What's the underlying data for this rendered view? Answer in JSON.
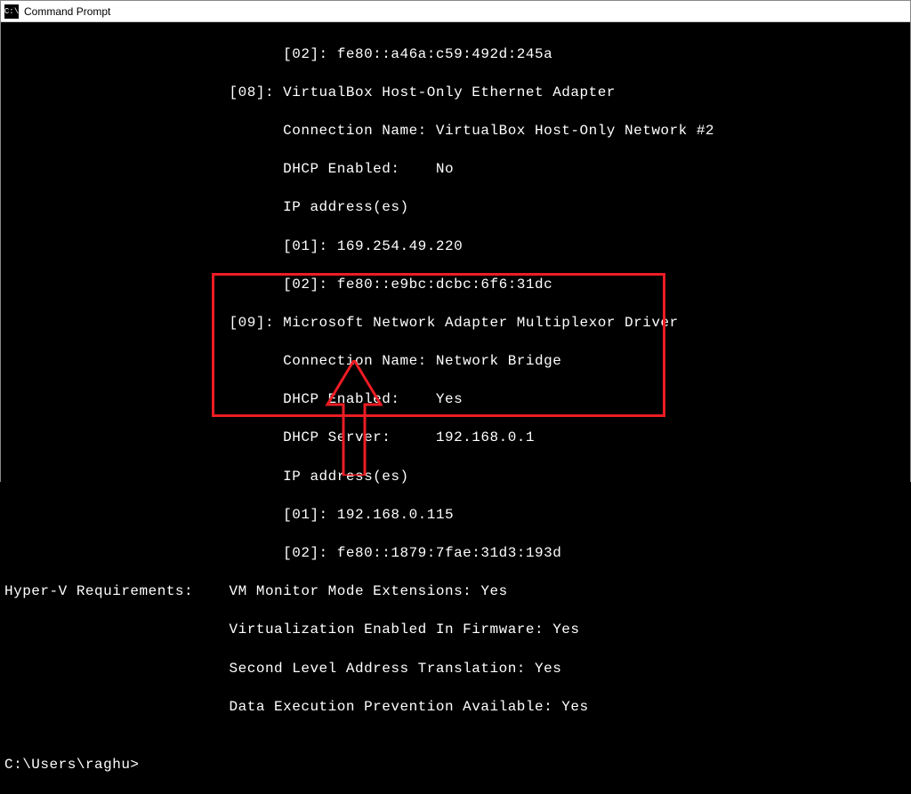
{
  "window": {
    "title": "Command Prompt"
  },
  "lines": {
    "l0": "                               [02]: fe80::a46a:c59:492d:245a",
    "l1": "                         [08]: VirtualBox Host-Only Ethernet Adapter",
    "l2": "                               Connection Name: VirtualBox Host-Only Network #2",
    "l3": "                               DHCP Enabled:    No",
    "l4": "                               IP address(es)",
    "l5": "                               [01]: 169.254.49.220",
    "l6": "                               [02]: fe80::e9bc:dcbc:6f6:31dc",
    "l7": "                         [09]: Microsoft Network Adapter Multiplexor Driver",
    "l8": "                               Connection Name: Network Bridge",
    "l9": "                               DHCP Enabled:    Yes",
    "l10": "                               DHCP Server:     192.168.0.1",
    "l11": "                               IP address(es)",
    "l12": "                               [01]: 192.168.0.115",
    "l13": "                               [02]: fe80::1879:7fae:31d3:193d",
    "l14": "Hyper-V Requirements:    VM Monitor Mode Extensions: Yes",
    "l15": "                         Virtualization Enabled In Firmware: Yes",
    "l16": "                         Second Level Address Translation: Yes",
    "l17": "                         Data Execution Prevention Available: Yes",
    "l18": "",
    "prompt": "C:\\Users\\raghu>"
  },
  "annotation": {
    "color": "#ed1c24"
  }
}
